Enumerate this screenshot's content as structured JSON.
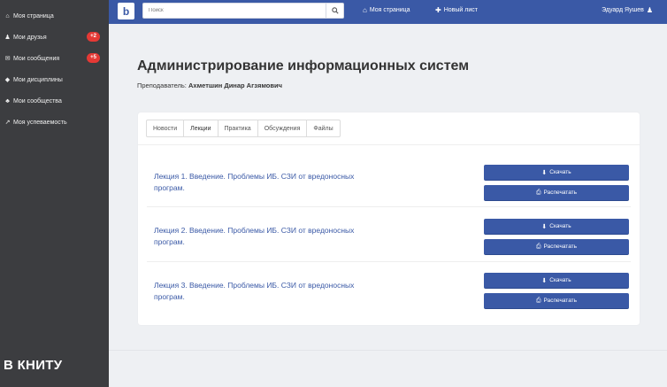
{
  "sidebar": {
    "items": [
      {
        "label": "Моя страница",
        "icon": "home-icon",
        "glyph": "⌂",
        "badge": ""
      },
      {
        "label": "Мои друзья",
        "icon": "user-icon",
        "glyph": "♟",
        "badge": "+2"
      },
      {
        "label": "Мои сообщения",
        "icon": "envelope-icon",
        "glyph": "✉",
        "badge": "+5"
      },
      {
        "label": "Мои дисциплины",
        "icon": "graduation-cap-icon",
        "glyph": "◆",
        "badge": ""
      },
      {
        "label": "Мои сообщества",
        "icon": "users-icon",
        "glyph": "♣",
        "badge": ""
      },
      {
        "label": "Моя успеваемость",
        "icon": "chart-line-icon",
        "glyph": "↗",
        "badge": ""
      }
    ],
    "brand": "В КНИТУ"
  },
  "topbar": {
    "logo": "b",
    "search_placeholder": "Поиск",
    "nav_my_page": "Моя страница",
    "nav_new_sheet": "Новый лист",
    "user_name": "Эдуард Яушев"
  },
  "page": {
    "title": "Администрирование информационных систем",
    "teacher_label": "Преподаватель:",
    "teacher_name": "Ахметшин Динар Агзямович"
  },
  "tabs": [
    "Новости",
    "Лекции",
    "Практика",
    "Обсуждения",
    "Файлы"
  ],
  "lectures": [
    {
      "line1": "Лекция 1. Введение. Проблемы ИБ. СЗИ от вредоносных",
      "line2": "програм."
    },
    {
      "line1": "Лекция 2. Введение. Проблемы ИБ. СЗИ от вредоносных",
      "line2": "програм."
    },
    {
      "line1": "Лекция 3. Введение. Проблемы ИБ. СЗИ от вредоносных",
      "line2": "програм."
    }
  ],
  "buttons": {
    "download": "Скачать",
    "print": "Распечатать"
  },
  "colors": {
    "accent": "#3a59a6",
    "sidebar": "#3c3d40",
    "badge": "#e53935"
  }
}
